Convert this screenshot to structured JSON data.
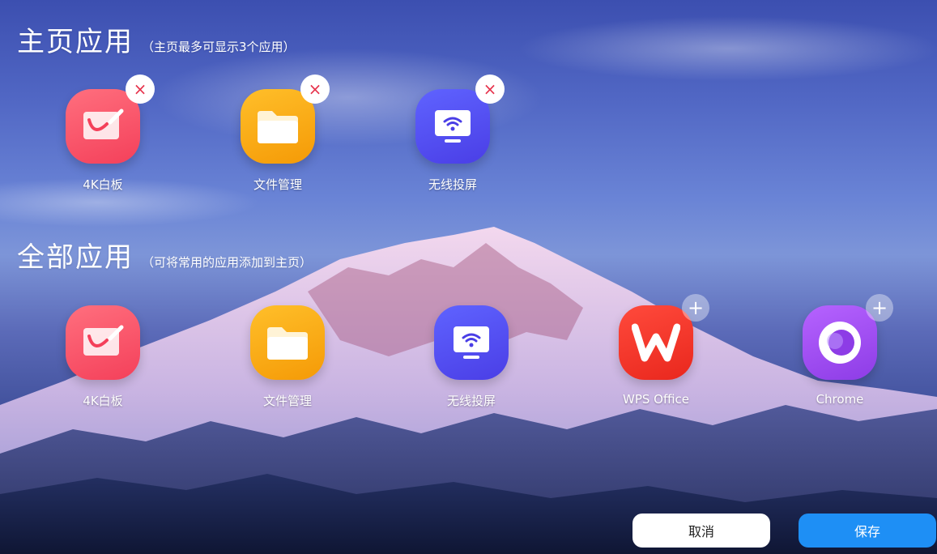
{
  "home_section": {
    "title": "主页应用",
    "hint": "（主页最多可显示3个应用）",
    "apps": [
      {
        "label": "4K白板",
        "icon": "whiteboard-icon",
        "action": "×",
        "action_icon": "remove-icon"
      },
      {
        "label": "文件管理",
        "icon": "folder-icon",
        "action": "×",
        "action_icon": "remove-icon"
      },
      {
        "label": "无线投屏",
        "icon": "wireless-cast-icon",
        "action": "×",
        "action_icon": "remove-icon"
      }
    ]
  },
  "all_section": {
    "title": "全部应用",
    "hint": "（可将常用的应用添加到主页）",
    "apps": [
      {
        "label": "4K白板",
        "icon": "whiteboard-icon"
      },
      {
        "label": "文件管理",
        "icon": "folder-icon"
      },
      {
        "label": "无线投屏",
        "icon": "wireless-cast-icon"
      },
      {
        "label": "WPS Office",
        "icon": "wps-icon",
        "action": "+",
        "action_icon": "add-icon"
      },
      {
        "label": "Chrome",
        "icon": "chrome-ring-icon",
        "action": "+",
        "action_icon": "add-icon"
      }
    ]
  },
  "footer": {
    "cancel_label": "取消",
    "save_label": "保存"
  },
  "colors": {
    "save_button": "#1e8ff5",
    "remove_badge": "#e6334c",
    "whiteboard": "#f4405a",
    "files": "#f59a06",
    "cast": "#4a3ee6",
    "wps": "#e9271d",
    "chrome": "#8d3ce6"
  }
}
